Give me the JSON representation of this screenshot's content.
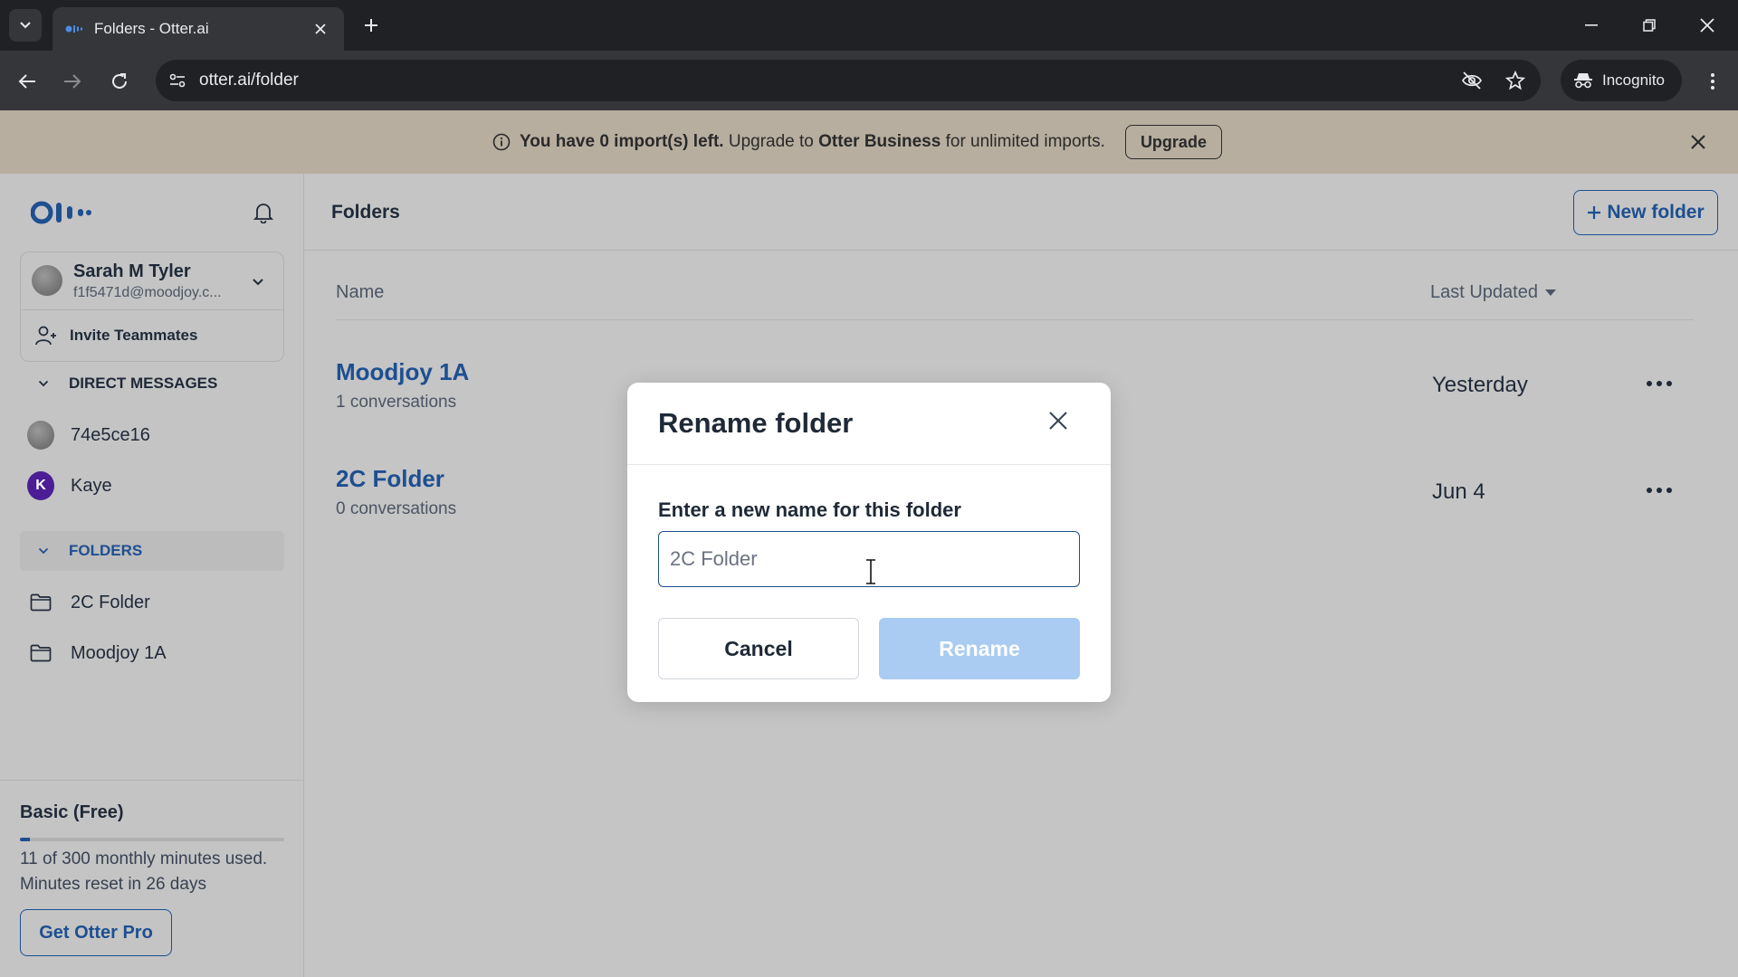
{
  "browser": {
    "tab_title": "Folders - Otter.ai",
    "url": "otter.ai/folder",
    "incognito_label": "Incognito"
  },
  "banner": {
    "text_bold": "You have 0 import(s) left.",
    "text_pre": "Upgrade to",
    "text_brand": "Otter Business",
    "text_post": "for unlimited imports.",
    "upgrade_label": "Upgrade"
  },
  "sidebar": {
    "user_name": "Sarah M Tyler",
    "user_email": "f1f5471d@moodjoy.c...",
    "invite_label": "Invite Teammates",
    "direct_messages_label": "DIRECT MESSAGES",
    "direct_messages": [
      {
        "name": "74e5ce16"
      },
      {
        "name": "Kaye",
        "initial": "K"
      }
    ],
    "folders_label": "FOLDERS",
    "folders": [
      {
        "name": "2C Folder"
      },
      {
        "name": "Moodjoy 1A"
      }
    ],
    "plan": {
      "title": "Basic (Free)",
      "minutes_used_fraction": 0.0367,
      "usage_line": "11 of 300 monthly minutes used.",
      "reset_line": "Minutes reset in 26 days"
    },
    "get_pro_label": "Get Otter Pro"
  },
  "main": {
    "title": "Folders",
    "new_folder_label": "New folder",
    "col_name": "Name",
    "col_updated": "Last Updated",
    "folders": [
      {
        "name": "Moodjoy 1A",
        "count": "1 conversations",
        "date": "Yesterday"
      },
      {
        "name": "2C Folder",
        "count": "0 conversations",
        "date": "Jun 4"
      }
    ]
  },
  "modal": {
    "title": "Rename folder",
    "label": "Enter a new name for this folder",
    "input_value": "2C Folder",
    "cancel_label": "Cancel",
    "rename_label": "Rename"
  },
  "colors": {
    "brand_blue": "#1d4f91",
    "rename_disabled": "#aacbf2",
    "banner_bg": "#b7ae9f"
  }
}
